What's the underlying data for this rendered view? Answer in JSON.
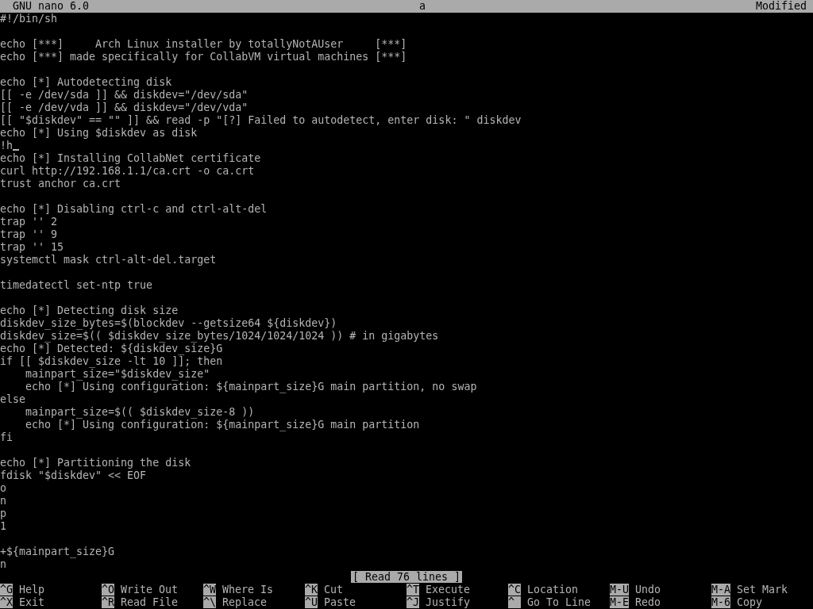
{
  "title_bar": {
    "app": "GNU nano 6.0",
    "file": "a",
    "state": "Modified"
  },
  "editor": {
    "blocks": [
      [
        "#!/bin/sh"
      ],
      [
        "echo [***]     Arch Linux installer by totallyNotAUser     [***]",
        "echo [***] made specifically for CollabVM virtual machines [***]"
      ],
      [
        "echo [*] Autodetecting disk",
        "[[ -e /dev/sda ]] && diskdev=\"/dev/sda\"",
        "[[ -e /dev/vda ]] && diskdev=\"/dev/vda\"",
        "[[ \"$diskdev\" == \"\" ]] && read -p \"[?] Failed to autodetect, enter disk: \" diskdev",
        "echo [*] Using $diskdev as disk",
        {
          "text": "!h",
          "cursor": true
        },
        "echo [*] Installing CollabNet certificate",
        "curl http://192.168.1.1/ca.crt -o ca.crt",
        "trust anchor ca.crt"
      ],
      [
        "echo [*] Disabling ctrl-c and ctrl-alt-del",
        "trap '' 2",
        "trap '' 9",
        "trap '' 15",
        "systemctl mask ctrl-alt-del.target"
      ],
      [
        "timedatectl set-ntp true"
      ],
      [
        "echo [*] Detecting disk size",
        "diskdev_size_bytes=$(blockdev --getsize64 ${diskdev})",
        "diskdev_size=$(( $diskdev_size_bytes/1024/1024/1024 )) # in gigabytes",
        "echo [*] Detected: ${diskdev_size}G",
        "if [[ $diskdev_size -lt 10 ]]; then",
        "    mainpart_size=\"$diskdev_size\"",
        "    echo [*] Using configuration: ${mainpart_size}G main partition, no swap",
        "else",
        "    mainpart_size=$(( $diskdev_size-8 ))",
        "    echo [*] Using configuration: ${mainpart_size}G main partition",
        "fi"
      ],
      [
        "echo [*] Partitioning the disk",
        "fdisk \"$diskdev\" << EOF",
        "o",
        "n",
        "p",
        "1"
      ],
      [
        "+${mainpart_size}G",
        "n"
      ]
    ]
  },
  "status_message": "[ Read 76 lines ]",
  "shortcuts": [
    [
      {
        "key": "^G",
        "label": "Help"
      },
      {
        "key": "^X",
        "label": "Exit"
      }
    ],
    [
      {
        "key": "^O",
        "label": "Write Out"
      },
      {
        "key": "^R",
        "label": "Read File"
      }
    ],
    [
      {
        "key": "^W",
        "label": "Where Is"
      },
      {
        "key": "^\\",
        "label": "Replace"
      }
    ],
    [
      {
        "key": "^K",
        "label": "Cut"
      },
      {
        "key": "^U",
        "label": "Paste"
      }
    ],
    [
      {
        "key": "^T",
        "label": "Execute"
      },
      {
        "key": "^J",
        "label": "Justify"
      }
    ],
    [
      {
        "key": "^C",
        "label": "Location"
      },
      {
        "key": "^_",
        "label": "Go To Line"
      }
    ],
    [
      {
        "key": "M-U",
        "label": "Undo"
      },
      {
        "key": "M-E",
        "label": "Redo"
      }
    ],
    [
      {
        "key": "M-A",
        "label": "Set Mark"
      },
      {
        "key": "M-6",
        "label": "Copy"
      }
    ]
  ]
}
